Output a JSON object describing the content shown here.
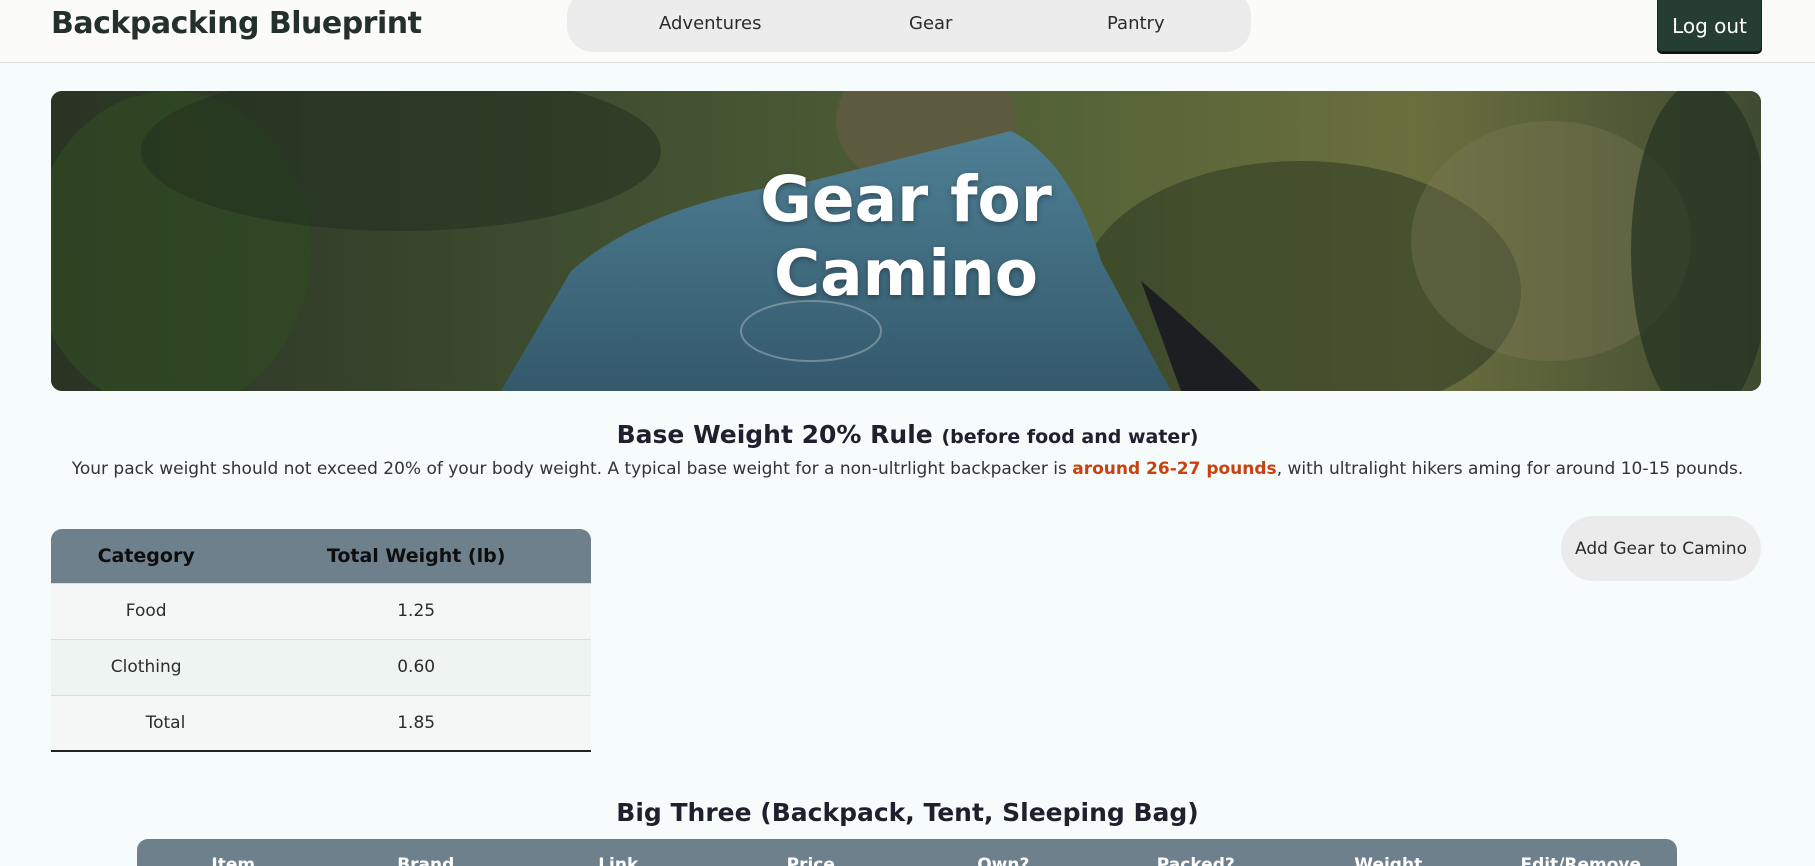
{
  "header": {
    "brand": "Backpacking Blueprint",
    "nav": [
      "Adventures",
      "Gear",
      "Pantry"
    ],
    "logout_label": "Log out"
  },
  "hero": {
    "title_line1": "Gear for",
    "title_line2": "Camino"
  },
  "rule": {
    "heading": "Base Weight 20% Rule",
    "heading_note": "(before food and water)",
    "text_before": "Your pack weight should not exceed 20% of your body weight. A typical base weight for a non-ultrlight backpacker is ",
    "text_highlight": "around 26-27 pounds",
    "text_after": ", with ultralight hikers aming for around 10-15 pounds."
  },
  "summary": {
    "headers": [
      "Category",
      "Total Weight (lb)"
    ],
    "rows": [
      {
        "category": "Food",
        "weight": "1.25"
      },
      {
        "category": "Clothing",
        "weight": "0.60"
      }
    ],
    "total_label": "Total",
    "total_value": "1.85"
  },
  "actions": {
    "add_gear_label": "Add Gear to Camino"
  },
  "big_three": {
    "heading": "Big Three (Backpack, Tent, Sleeping Bag)",
    "columns": [
      "Item",
      "Brand",
      "Link",
      "Price",
      "Own?",
      "Packed?",
      "Weight",
      "Edit/Remove"
    ]
  },
  "colors": {
    "accent_dark": "#263d33",
    "table_header": "#6e808c",
    "highlight": "#c9410f"
  }
}
